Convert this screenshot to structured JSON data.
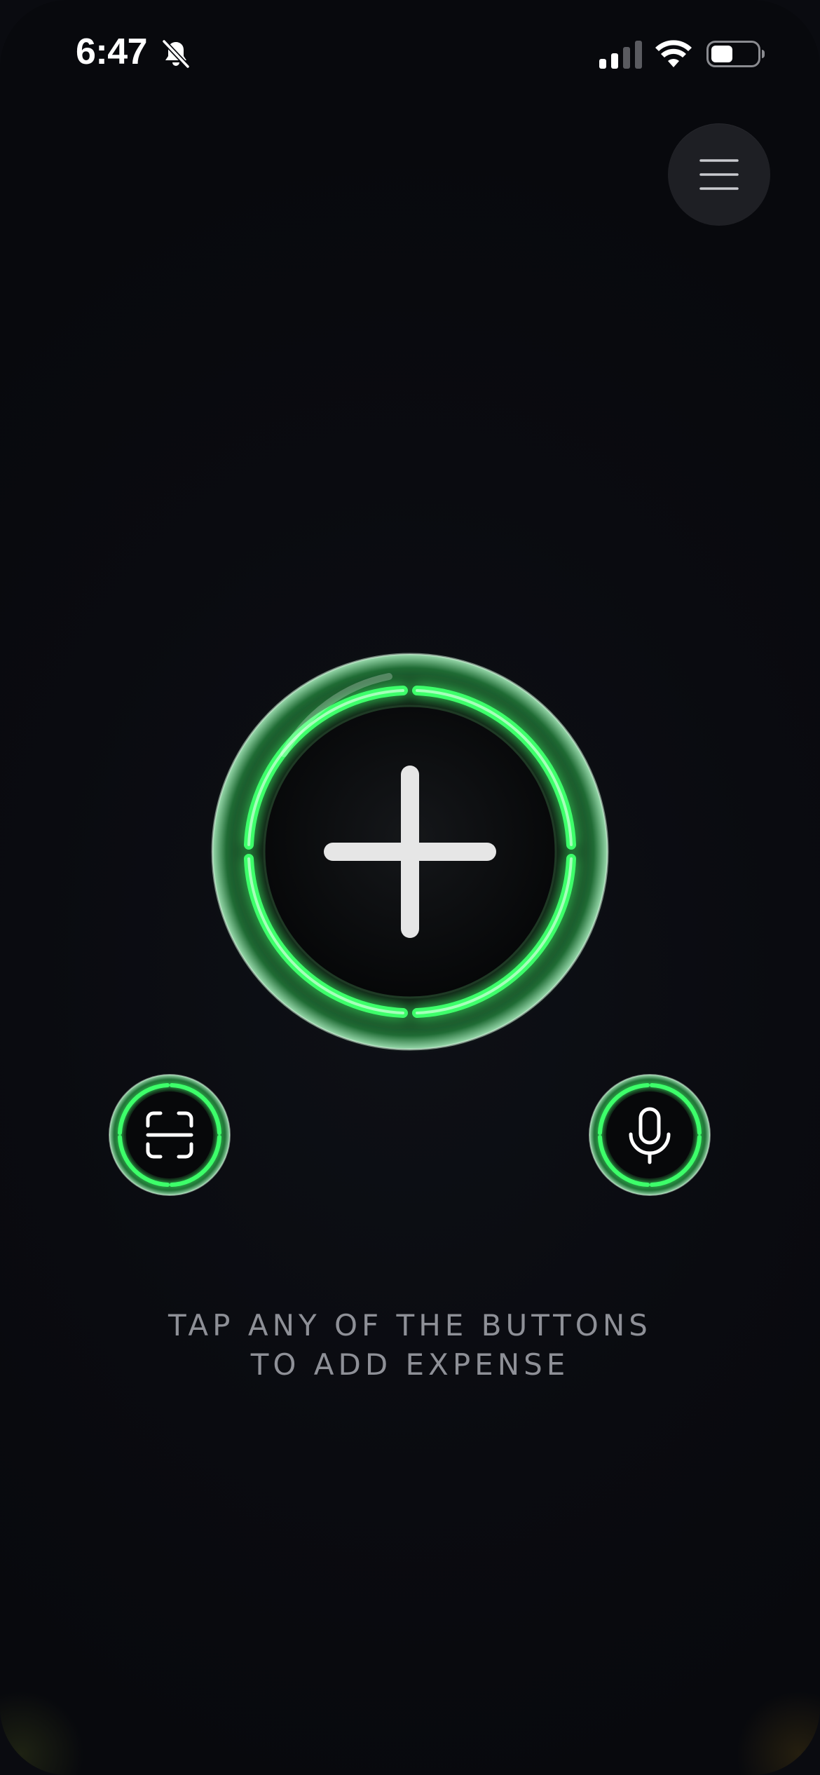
{
  "status_bar": {
    "time": "6:47",
    "icons": [
      "bell-slash-icon",
      "cellular-signal-icon",
      "wifi-icon",
      "battery-icon"
    ]
  },
  "header": {
    "menu_icon": "hamburger-menu-icon"
  },
  "actions": {
    "add_icon": "plus-icon",
    "scan_icon": "scan-icon",
    "mic_icon": "microphone-icon"
  },
  "hint": {
    "line1": "TAP ANY OF THE BUTTONS",
    "line2": "TO ADD EXPENSE"
  },
  "colors": {
    "background": "#0a0b10",
    "accent_green": "#3dff6a",
    "text_muted": "#8e9097",
    "menu_button_bg": "#1e1f24"
  }
}
